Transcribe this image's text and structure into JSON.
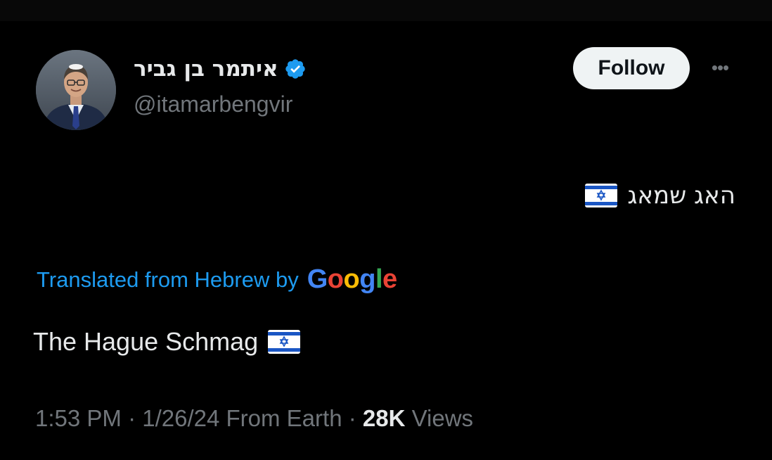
{
  "author": {
    "display_name": "איתמר בן גביר",
    "handle": "@itamarbengvir",
    "verified": true
  },
  "actions": {
    "follow_label": "Follow",
    "more_label": "•••"
  },
  "tweet": {
    "original_text": "האג שמאג",
    "translated_from_label": "Translated from Hebrew by",
    "translator_logo": [
      "G",
      "o",
      "o",
      "g",
      "l",
      "e"
    ],
    "translation_text": "The Hague Schmag",
    "flag_emoji": "israel-flag-icon"
  },
  "meta": {
    "time": "1:53 PM",
    "sep1": " · ",
    "date": "1/26/24",
    "source": " From Earth",
    "sep2": " · ",
    "views_count": "28K",
    "views_label": " Views"
  },
  "colors": {
    "background": "#000000",
    "link_blue": "#1d9bf0",
    "muted_gray": "#71767b",
    "google_blue": "#4285f4",
    "google_red": "#ea4335",
    "google_yellow": "#fbbc05",
    "google_green": "#34a853"
  }
}
